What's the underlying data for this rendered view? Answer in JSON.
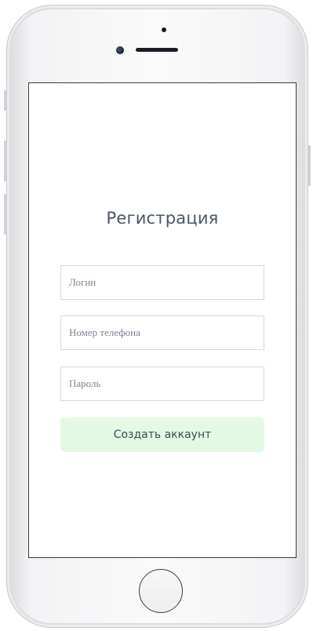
{
  "register": {
    "title": "Регистрация",
    "login_placeholder": "Логин",
    "phone_placeholder": "Номер телефона",
    "password_placeholder": "Пароль",
    "submit_label": "Создать аккаунт"
  },
  "colors": {
    "button_bg": "#e3f9e3",
    "title_text": "#4a5566",
    "field_border": "#d6d9de"
  }
}
